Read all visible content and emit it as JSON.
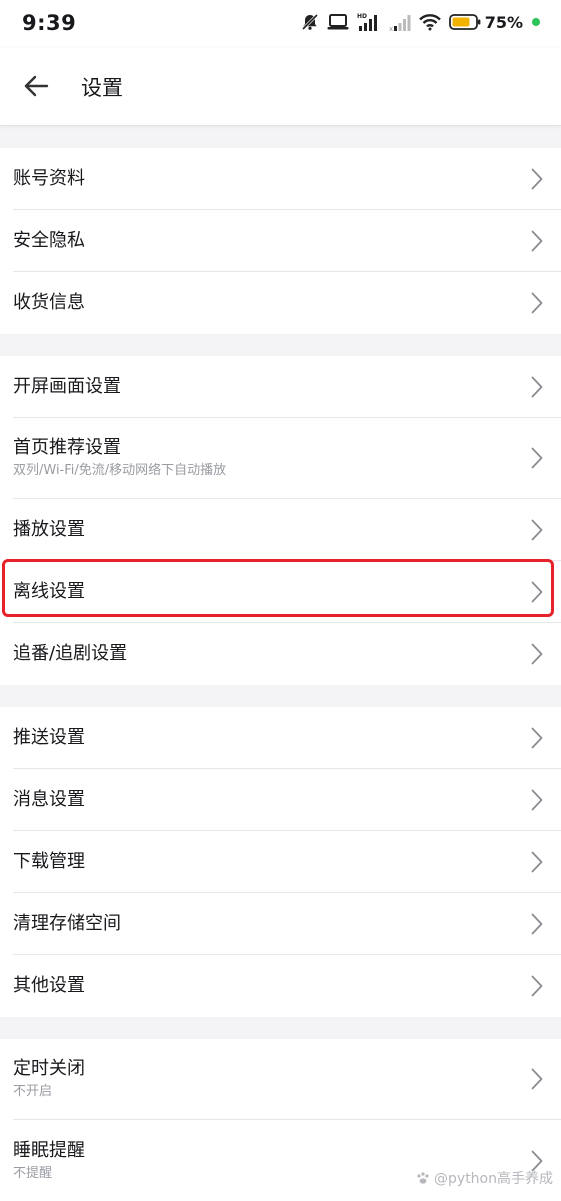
{
  "status": {
    "time": "9:39",
    "battery_percent": "75%",
    "icons": [
      "mute-icon",
      "laptop-icon",
      "hd-signal-icon",
      "signal-weak-icon",
      "wifi-icon",
      "battery-icon",
      "charging-dot-icon"
    ]
  },
  "header": {
    "title": "设置",
    "back_icon": "arrow-left-icon"
  },
  "groups": [
    [
      {
        "label": "账号资料"
      },
      {
        "label": "安全隐私"
      },
      {
        "label": "收货信息"
      }
    ],
    [
      {
        "label": "开屏画面设置"
      },
      {
        "label": "首页推荐设置",
        "sub": "双列/Wi-Fi/免流/移动网络下自动播放"
      },
      {
        "label": "播放设置"
      },
      {
        "label": "离线设置",
        "highlighted": true
      },
      {
        "label": "追番/追剧设置"
      }
    ],
    [
      {
        "label": "推送设置"
      },
      {
        "label": "消息设置"
      },
      {
        "label": "下载管理"
      },
      {
        "label": "清理存储空间"
      },
      {
        "label": "其他设置"
      }
    ],
    [
      {
        "label": "定时关闭",
        "sub": "不开启"
      },
      {
        "label": "睡眠提醒",
        "sub": "不提醒"
      }
    ]
  ],
  "watermark": "@python高手养成",
  "colors": {
    "highlight": "#e8222a",
    "background": "#f4f4f6",
    "text": "#18191c",
    "subtext": "#9a9ca3"
  }
}
